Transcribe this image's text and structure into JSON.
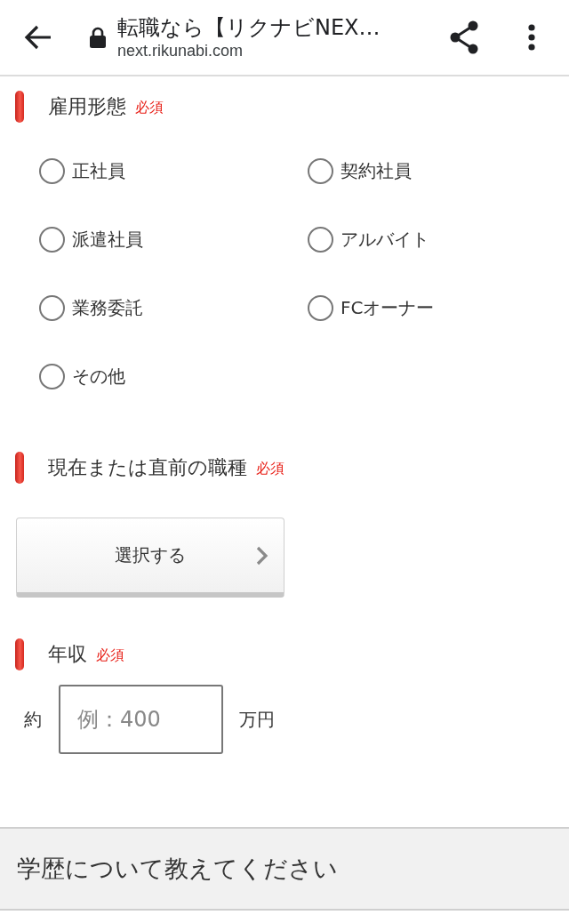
{
  "browser_bar": {
    "title": "転職なら【リクナビNEX…",
    "url": "next.rikunabi.com"
  },
  "sections": [
    {
      "kind": "radio_group",
      "title": "雇用形態",
      "badge": "必須",
      "options": [
        {
          "label": "正社員",
          "selected": false
        },
        {
          "label": "契約社員",
          "selected": false
        },
        {
          "label": "派遣社員",
          "selected": false
        },
        {
          "label": "アルバイト",
          "selected": false
        },
        {
          "label": "業務委託",
          "selected": false
        },
        {
          "label": "FCオーナー",
          "selected": false
        },
        {
          "label": "その他",
          "selected": false
        }
      ]
    },
    {
      "kind": "select",
      "title": "現在または直前の職種",
      "badge": "必須",
      "button": "選択する"
    },
    {
      "kind": "amount",
      "title": "年収",
      "badge": "必須",
      "prefix": "約",
      "placeholder": "例：400",
      "suffix": "万円"
    }
  ],
  "next_section": {
    "title": "学歴について教えてください"
  }
}
